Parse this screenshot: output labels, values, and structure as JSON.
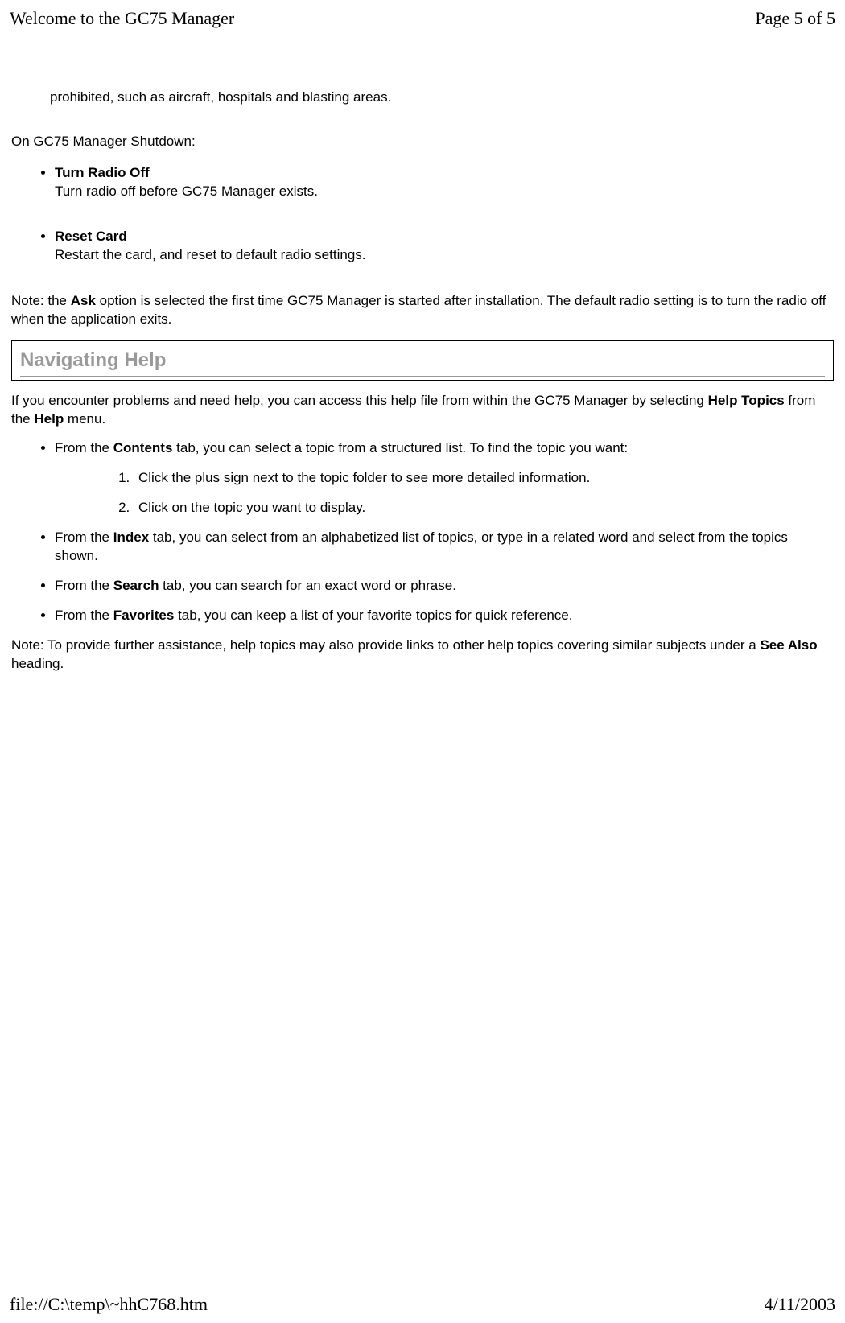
{
  "header": {
    "title": "Welcome to the GC75 Manager",
    "page": "Page 5 of 5"
  },
  "top_fragment": "prohibited, such as aircraft, hospitals and blasting areas.",
  "shutdown": {
    "heading": "On GC75 Manager Shutdown:",
    "items": [
      {
        "title": "Turn Radio Off",
        "desc": "Turn radio off before GC75 Manager exists."
      },
      {
        "title": "Reset Card",
        "desc": "Restart the card, and reset to default radio settings."
      }
    ]
  },
  "note1": {
    "prefix": "Note: the ",
    "bold": "Ask",
    "suffix": " option is selected the first time GC75 Manager is started after installation. The default radio setting is to turn the radio off when the application exits."
  },
  "nav_heading": "Navigating Help",
  "nav_intro": {
    "p1": "If you encounter problems and need help, you can access this help file from within the GC75 Manager by selecting ",
    "b1": "Help Topics",
    "p2": " from the ",
    "b2": "Help",
    "p3": " menu."
  },
  "nav_list": {
    "contents": {
      "prefix": "From the ",
      "bold": "Contents",
      "suffix": " tab, you can select a topic from a structured list. To find the topic you want:",
      "steps": [
        "Click the plus sign next to the topic folder to see more detailed information.",
        "Click on the topic you want to display."
      ]
    },
    "index": {
      "prefix": "From the ",
      "bold": "Index",
      "suffix": " tab, you can select from an alphabetized list of topics, or type in a related word and select from the topics shown."
    },
    "search": {
      "prefix": "From the ",
      "bold": "Search",
      "suffix": " tab, you can search for an exact word or phrase."
    },
    "favorites": {
      "prefix": "From the ",
      "bold": "Favorites",
      "suffix": " tab, you can keep a list of your favorite topics for quick reference."
    }
  },
  "note2": {
    "prefix": "Note: To provide further assistance, help topics may also provide links to other help topics covering similar subjects under a ",
    "bold": "See Also",
    "suffix": " heading."
  },
  "footer": {
    "path": "file://C:\\temp\\~hhC768.htm",
    "date": "4/11/2003"
  }
}
